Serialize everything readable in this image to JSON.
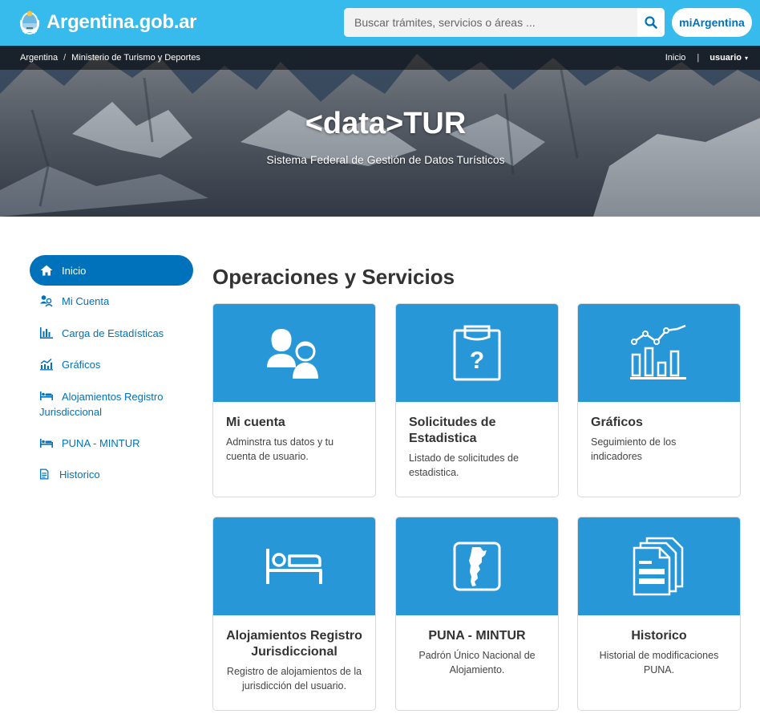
{
  "header": {
    "brand": "Argentina.gob.ar",
    "search_placeholder": "Buscar trámites, servicios o áreas ...",
    "mi_argentina": "miArgentina"
  },
  "breadcrumb": {
    "items": [
      "Argentina",
      "Ministerio de Turismo y Deportes"
    ],
    "separator": "/"
  },
  "topnav": {
    "inicio": "Inicio",
    "divider": "|",
    "user": "usuario",
    "caret": "▾"
  },
  "hero": {
    "title": "<data>TUR",
    "subtitle": "Sistema Federal de Gestión de Datos Turísticos"
  },
  "sidebar": {
    "items": [
      {
        "label": "Inicio",
        "icon": "home-icon",
        "active": true
      },
      {
        "label": "Mi Cuenta",
        "icon": "users-icon"
      },
      {
        "label": "Carga de Estadísticas",
        "icon": "bar-chart-icon"
      },
      {
        "label": "Gráficos",
        "icon": "line-chart-icon"
      },
      {
        "label": "Alojamientos Registro Jurisdiccional",
        "icon": "bed-icon"
      },
      {
        "label": "PUNA - MINTUR",
        "icon": "bed-icon"
      },
      {
        "label": "Historico",
        "icon": "document-icon"
      }
    ]
  },
  "main": {
    "title": "Operaciones y Servicios",
    "cards": [
      {
        "title": "Mi cuenta",
        "desc": "Adminstra tus datos y tu cuenta de usuario.",
        "icon": "users-icon"
      },
      {
        "title": "Solicitudes de Estadistica",
        "desc": "Listado de solicitudes de estadistica.",
        "icon": "clipboard-question-icon"
      },
      {
        "title": "Gráficos",
        "desc": "Seguimiento de los indicadores",
        "icon": "chart-icon"
      },
      {
        "title": "Alojamientos Registro Jurisdiccional",
        "desc": "Registro de alojamientos de la jurisdicción del usuario.",
        "icon": "bed-icon"
      },
      {
        "title": "PUNA - MINTUR",
        "desc": "Padrón Único Nacional de Alojamiento.",
        "icon": "argentina-map-icon"
      },
      {
        "title": "Historico",
        "desc": "Historial de modificaciones PUNA.",
        "icon": "documents-icon"
      }
    ]
  },
  "colors": {
    "header": "#37bbed",
    "primary": "#0072bb",
    "card_top": "#2897d8"
  }
}
